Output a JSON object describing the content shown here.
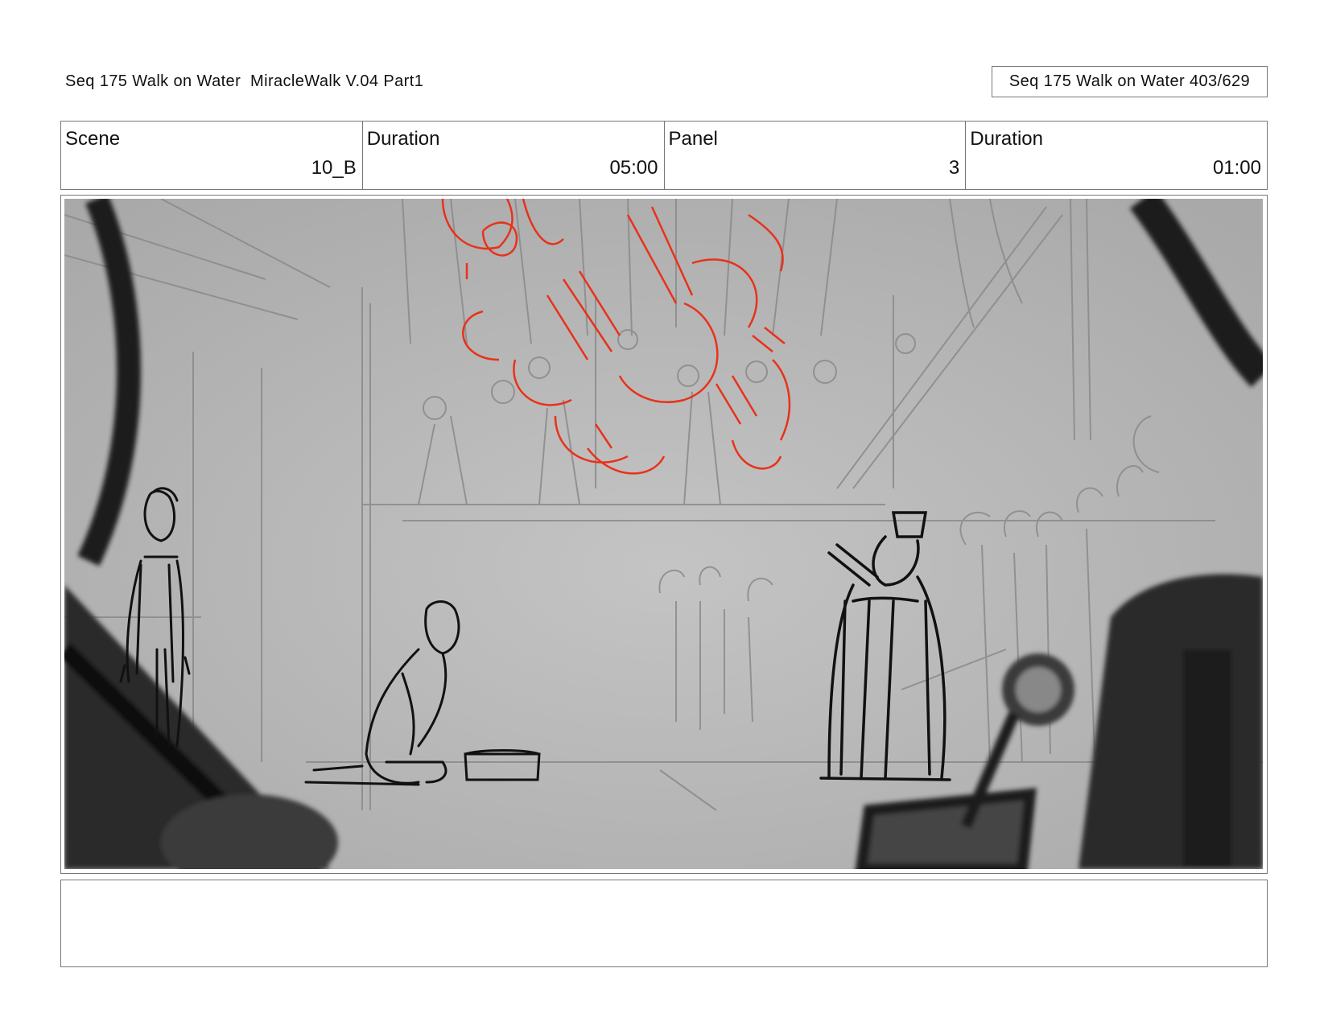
{
  "header": {
    "title": "Seq 175 Walk on Water  MiracleWalk V.04 Part1",
    "page_ref": "Seq 175 Walk on Water 403/629"
  },
  "info": {
    "scene_label": "Scene",
    "scene_value": "10_B",
    "scene_duration_label": "Duration",
    "scene_duration_value": "05:00",
    "panel_label": "Panel",
    "panel_value": "3",
    "panel_duration_label": "Duration",
    "panel_duration_value": "01:00"
  },
  "panel": {
    "sketch_lines": "#8a8a8a",
    "ink_lines": "#111111",
    "fire_lines": "#e8321a",
    "background": "#b9b9b9"
  },
  "notes": {
    "text": ""
  }
}
